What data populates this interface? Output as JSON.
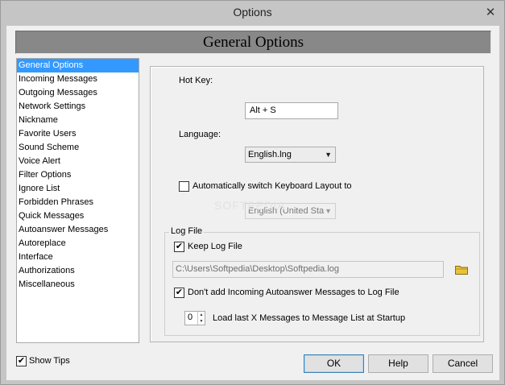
{
  "window": {
    "title": "Options",
    "close_glyph": "✕"
  },
  "header": {
    "title": "General Options"
  },
  "nav": {
    "items": [
      "General Options",
      "Incoming Messages",
      "Outgoing Messages",
      "Network Settings",
      "Nickname",
      "Favorite Users",
      "Sound Scheme",
      "Voice Alert",
      "Filter Options",
      "Ignore List",
      "Forbidden Phrases",
      "Quick Messages",
      "Autoanswer Messages",
      "Autoreplace",
      "Interface",
      "Authorizations",
      "Miscellaneous"
    ],
    "selected_index": 0
  },
  "general": {
    "hotkey_label": "Hot Key:",
    "hotkey_value": "Alt + S",
    "language_label": "Language:",
    "language_value": "English.lng",
    "auto_switch_label": "Automatically switch Keyboard Layout to",
    "auto_switch_checked": false,
    "keyboard_layout_value": "English (United Sta"
  },
  "log": {
    "group_title": "Log File",
    "keep_label": "Keep Log File",
    "keep_checked": true,
    "path": "C:\\Users\\Softpedia\\Desktop\\Softpedia.log",
    "dont_add_label": "Don't add Incoming Autoanswer Messages to Log File",
    "dont_add_checked": true,
    "load_count": "0",
    "load_label": "Load last X Messages to Message List at Startup"
  },
  "footer": {
    "show_tips_label": "Show Tips",
    "show_tips_checked": true,
    "ok_label": "OK",
    "help_label": "Help",
    "cancel_label": "Cancel"
  },
  "watermark": "SOFTPEDIA",
  "colors": {
    "selection": "#3399ff",
    "header_bar": "#888888",
    "folder_icon": "#e8c23a"
  },
  "icons": {
    "close": "close-icon",
    "dropdown": "chevron-down-icon",
    "folder": "folder-icon",
    "check": "checkmark-icon"
  }
}
